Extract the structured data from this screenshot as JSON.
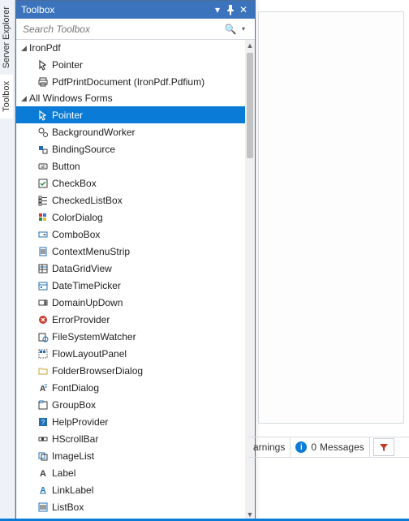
{
  "title": "Toolbox",
  "search": {
    "placeholder": "Search Toolbox"
  },
  "vtabs": [
    "Server Explorer",
    "Toolbox"
  ],
  "categories": [
    {
      "name": "IronPdf",
      "expanded": true,
      "items": [
        {
          "label": "Pointer",
          "icon": "pointer",
          "sel": false
        },
        {
          "label": "PdfPrintDocument (IronPdf.Pdfium)",
          "icon": "print",
          "sel": false
        }
      ]
    },
    {
      "name": "All Windows Forms",
      "expanded": true,
      "items": [
        {
          "label": "Pointer",
          "icon": "pointer",
          "sel": true
        },
        {
          "label": "BackgroundWorker",
          "icon": "gears",
          "sel": false
        },
        {
          "label": "BindingSource",
          "icon": "bindsrc",
          "sel": false
        },
        {
          "label": "Button",
          "icon": "button",
          "sel": false
        },
        {
          "label": "CheckBox",
          "icon": "checkbox",
          "sel": false
        },
        {
          "label": "CheckedListBox",
          "icon": "checkedlist",
          "sel": false
        },
        {
          "label": "ColorDialog",
          "icon": "colordlg",
          "sel": false
        },
        {
          "label": "ComboBox",
          "icon": "combo",
          "sel": false
        },
        {
          "label": "ContextMenuStrip",
          "icon": "context",
          "sel": false
        },
        {
          "label": "DataGridView",
          "icon": "grid",
          "sel": false
        },
        {
          "label": "DateTimePicker",
          "icon": "datetime",
          "sel": false
        },
        {
          "label": "DomainUpDown",
          "icon": "domainud",
          "sel": false
        },
        {
          "label": "ErrorProvider",
          "icon": "error",
          "sel": false
        },
        {
          "label": "FileSystemWatcher",
          "icon": "fswatch",
          "sel": false
        },
        {
          "label": "FlowLayoutPanel",
          "icon": "flow",
          "sel": false
        },
        {
          "label": "FolderBrowserDialog",
          "icon": "folder",
          "sel": false
        },
        {
          "label": "FontDialog",
          "icon": "fontdlg",
          "sel": false
        },
        {
          "label": "GroupBox",
          "icon": "groupbox",
          "sel": false
        },
        {
          "label": "HelpProvider",
          "icon": "help",
          "sel": false
        },
        {
          "label": "HScrollBar",
          "icon": "hscroll",
          "sel": false
        },
        {
          "label": "ImageList",
          "icon": "imagelist",
          "sel": false
        },
        {
          "label": "Label",
          "icon": "labelA",
          "sel": false
        },
        {
          "label": "LinkLabel",
          "icon": "linklabel",
          "sel": false
        },
        {
          "label": "ListBox",
          "icon": "listbox",
          "sel": false
        }
      ]
    }
  ],
  "status": {
    "warnings_label": "arnings",
    "messages_count": 0,
    "messages_label": "Messages"
  }
}
